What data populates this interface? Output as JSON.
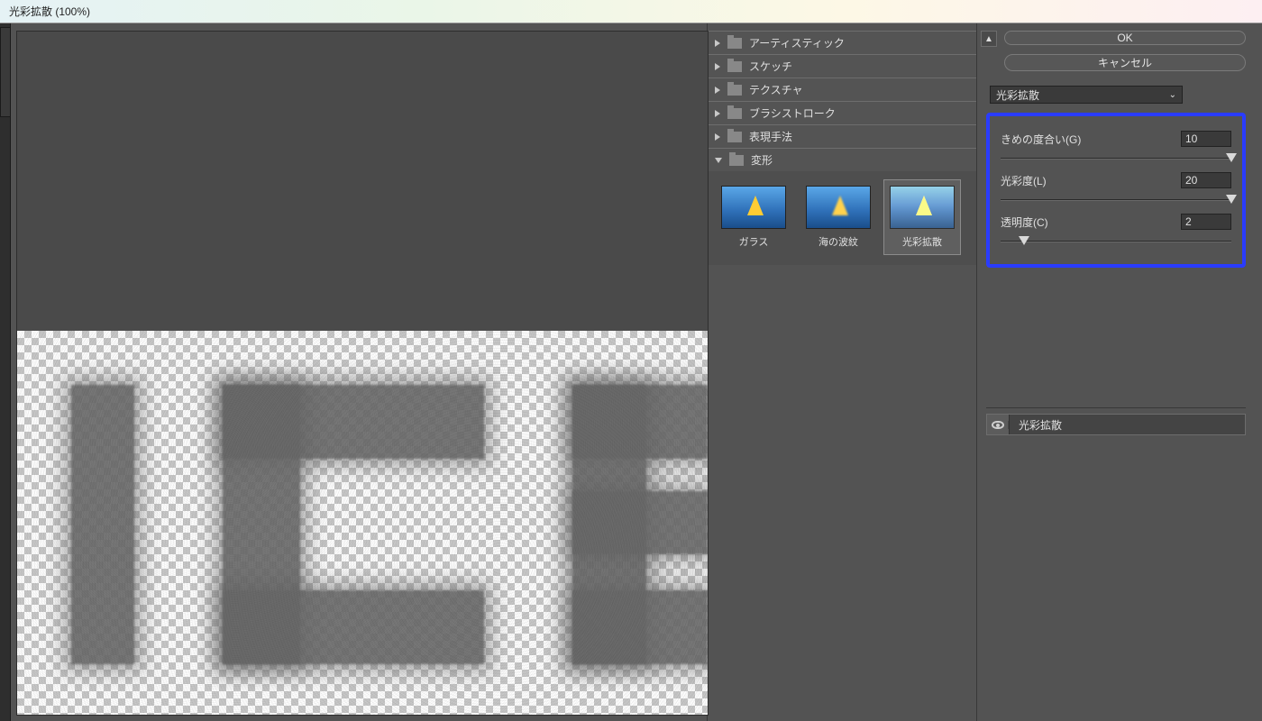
{
  "title": "光彩拡散 (100%)",
  "categories": [
    {
      "label": "アーティスティック",
      "expanded": false
    },
    {
      "label": "スケッチ",
      "expanded": false
    },
    {
      "label": "テクスチャ",
      "expanded": false
    },
    {
      "label": "ブラシストローク",
      "expanded": false
    },
    {
      "label": "表現手法",
      "expanded": false
    },
    {
      "label": "変形",
      "expanded": true
    }
  ],
  "thumbs": [
    {
      "label": "ガラス",
      "selected": false
    },
    {
      "label": "海の波紋",
      "selected": false
    },
    {
      "label": "光彩拡散",
      "selected": true
    }
  ],
  "buttons": {
    "ok": "OK",
    "cancel": "キャンセル"
  },
  "filter_name": "光彩拡散",
  "params": [
    {
      "label": "きめの度合い(G)",
      "value": "10",
      "pos": 100
    },
    {
      "label": "光彩度(L)",
      "value": "20",
      "pos": 100
    },
    {
      "label": "透明度(C)",
      "value": "2",
      "pos": 10
    }
  ],
  "layer": {
    "name": "光彩拡散"
  }
}
